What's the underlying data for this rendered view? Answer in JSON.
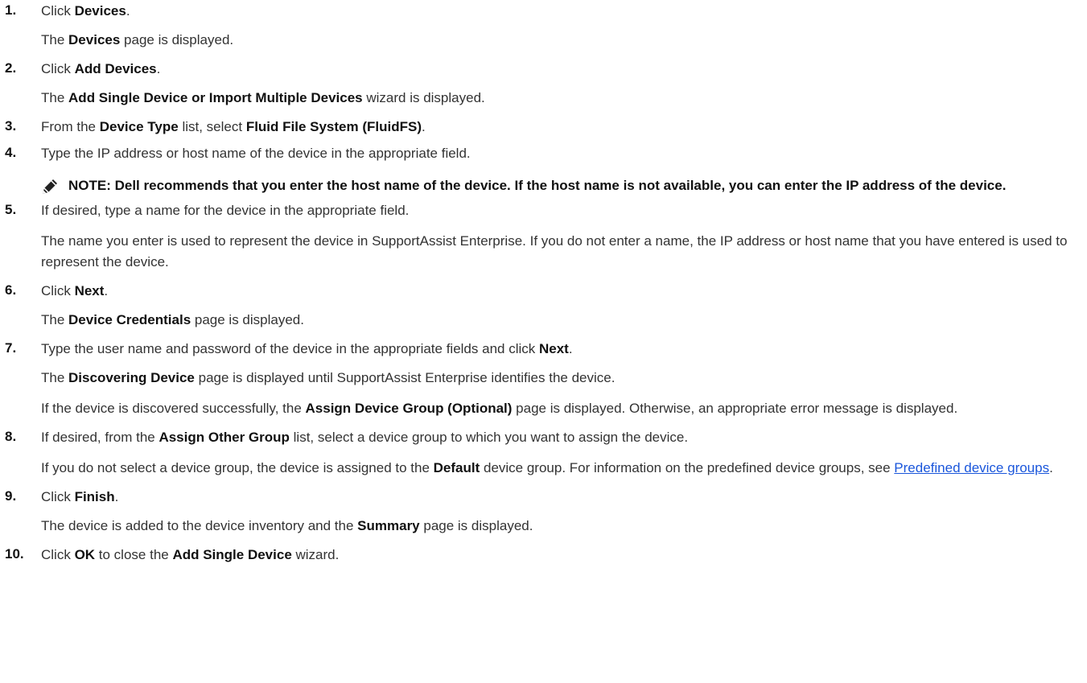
{
  "steps": [
    {
      "num": "1.",
      "lines": [
        [
          {
            "t": "Click "
          },
          {
            "t": "Devices",
            "b": true
          },
          {
            "t": "."
          }
        ],
        [
          {
            "t": "The "
          },
          {
            "t": "Devices",
            "b": true
          },
          {
            "t": " page is displayed."
          }
        ]
      ]
    },
    {
      "num": "2.",
      "lines": [
        [
          {
            "t": "Click "
          },
          {
            "t": "Add Devices",
            "b": true
          },
          {
            "t": "."
          }
        ],
        [
          {
            "t": "The "
          },
          {
            "t": "Add Single Device or Import Multiple Devices",
            "b": true
          },
          {
            "t": " wizard is displayed."
          }
        ]
      ]
    },
    {
      "num": "3.",
      "lines": [
        [
          {
            "t": "From the "
          },
          {
            "t": "Device Type",
            "b": true
          },
          {
            "t": " list, select "
          },
          {
            "t": "Fluid File System (FluidFS)",
            "b": true
          },
          {
            "t": "."
          }
        ]
      ]
    },
    {
      "num": "4.",
      "lines": [
        [
          {
            "t": "Type the IP address or host name of the device in the appropriate field."
          }
        ]
      ],
      "note": "NOTE: Dell recommends that you enter the host name of the device. If the host name is not available, you can enter the IP address of the device."
    },
    {
      "num": "5.",
      "lines": [
        [
          {
            "t": "If desired, type a name for the device in the appropriate field."
          }
        ],
        [
          {
            "t": "The name you enter is used to represent the device in SupportAssist Enterprise. If you do not enter a name, the IP address or host name that you have entered is used to represent the device."
          }
        ]
      ]
    },
    {
      "num": "6.",
      "lines": [
        [
          {
            "t": "Click "
          },
          {
            "t": "Next",
            "b": true
          },
          {
            "t": "."
          }
        ],
        [
          {
            "t": "The "
          },
          {
            "t": "Device Credentials",
            "b": true
          },
          {
            "t": " page is displayed."
          }
        ]
      ]
    },
    {
      "num": "7.",
      "lines": [
        [
          {
            "t": "Type the user name and password of the device in the appropriate fields and click "
          },
          {
            "t": "Next",
            "b": true
          },
          {
            "t": "."
          }
        ],
        [
          {
            "t": "The "
          },
          {
            "t": "Discovering Device",
            "b": true
          },
          {
            "t": " page is displayed until SupportAssist Enterprise identifies the device."
          }
        ],
        [
          {
            "t": "If the device is discovered successfully, the "
          },
          {
            "t": "Assign Device Group (Optional)",
            "b": true
          },
          {
            "t": " page is displayed. Otherwise, an appropriate error message is displayed."
          }
        ]
      ]
    },
    {
      "num": "8.",
      "lines": [
        [
          {
            "t": "If desired, from the "
          },
          {
            "t": "Assign Other Group",
            "b": true
          },
          {
            "t": " list, select a device group to which you want to assign the device."
          }
        ],
        [
          {
            "t": "If you do not select a device group, the device is assigned to the "
          },
          {
            "t": "Default",
            "b": true
          },
          {
            "t": " device group. For information on the predefined device groups, see "
          },
          {
            "t": "Predefined device groups",
            "link": true
          },
          {
            "t": "."
          }
        ]
      ]
    },
    {
      "num": "9.",
      "lines": [
        [
          {
            "t": "Click "
          },
          {
            "t": "Finish",
            "b": true
          },
          {
            "t": "."
          }
        ],
        [
          {
            "t": "The device is added to the device inventory and the "
          },
          {
            "t": "Summary",
            "b": true
          },
          {
            "t": " page is displayed."
          }
        ]
      ]
    },
    {
      "num": "10.",
      "lines": [
        [
          {
            "t": "Click "
          },
          {
            "t": "OK",
            "b": true
          },
          {
            "t": " to close the "
          },
          {
            "t": "Add Single Device",
            "b": true
          },
          {
            "t": " wizard."
          }
        ]
      ]
    }
  ]
}
